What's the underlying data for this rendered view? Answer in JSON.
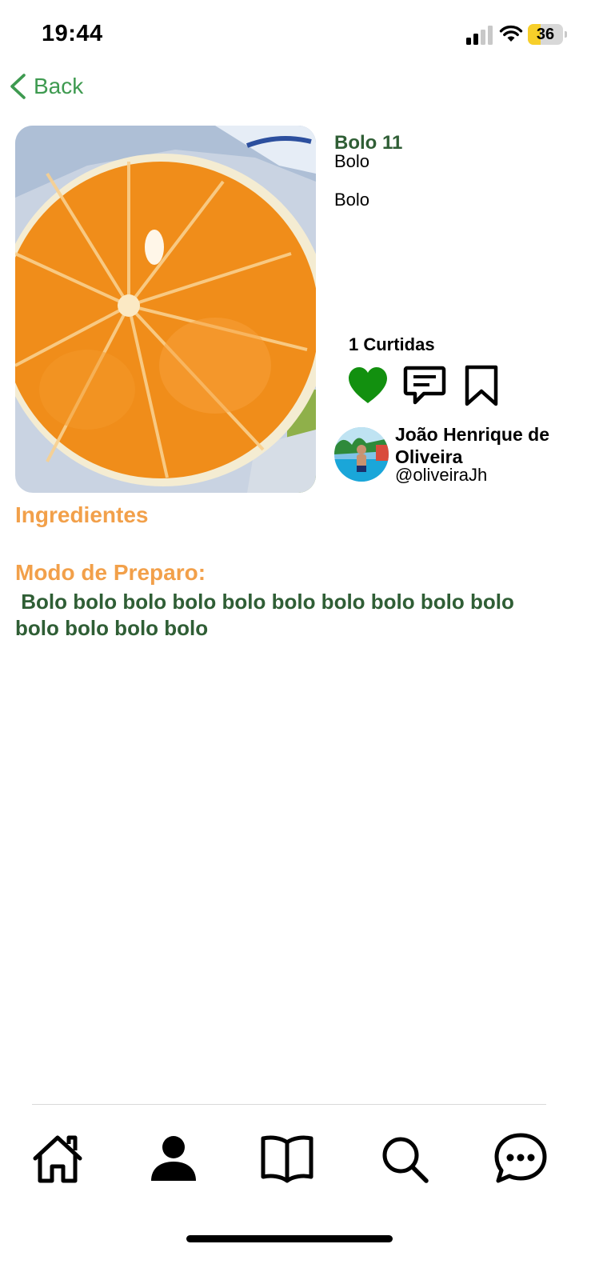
{
  "status_bar": {
    "time": "19:44",
    "battery_level": "36",
    "battery_fraction": 0.36
  },
  "header": {
    "back_label": "Back",
    "back_icon": "chevron-left-icon"
  },
  "recipe": {
    "image_subject": "orange slice",
    "title": "Bolo 11",
    "category": "Bolo",
    "description": "Bolo",
    "likes_label": "1 Curtidas",
    "liked": true
  },
  "actions": {
    "like_icon": "heart-icon",
    "comment_icon": "comment-icon",
    "save_icon": "bookmark-icon"
  },
  "author": {
    "name": "João Henrique de Oliveira",
    "handle": "@oliveiraJh"
  },
  "sections": {
    "ingredients_heading": "Ingredientes",
    "preparation_heading": "Modo de Preparo:",
    "preparation_text": " Bolo bolo bolo bolo bolo bolo bolo bolo bolo bolo bolo bolo bolo bolo"
  },
  "bottom_nav": [
    {
      "icon": "home-icon"
    },
    {
      "icon": "profile-icon",
      "active": true
    },
    {
      "icon": "book-icon"
    },
    {
      "icon": "search-icon"
    },
    {
      "icon": "chat-icon"
    }
  ],
  "colors": {
    "accent_green": "#3e9a50",
    "title_green": "#2f5e35",
    "heart_green": "#12900f",
    "heading_orange": "#f2a04a",
    "battery_yellow": "#f7cf2a"
  }
}
